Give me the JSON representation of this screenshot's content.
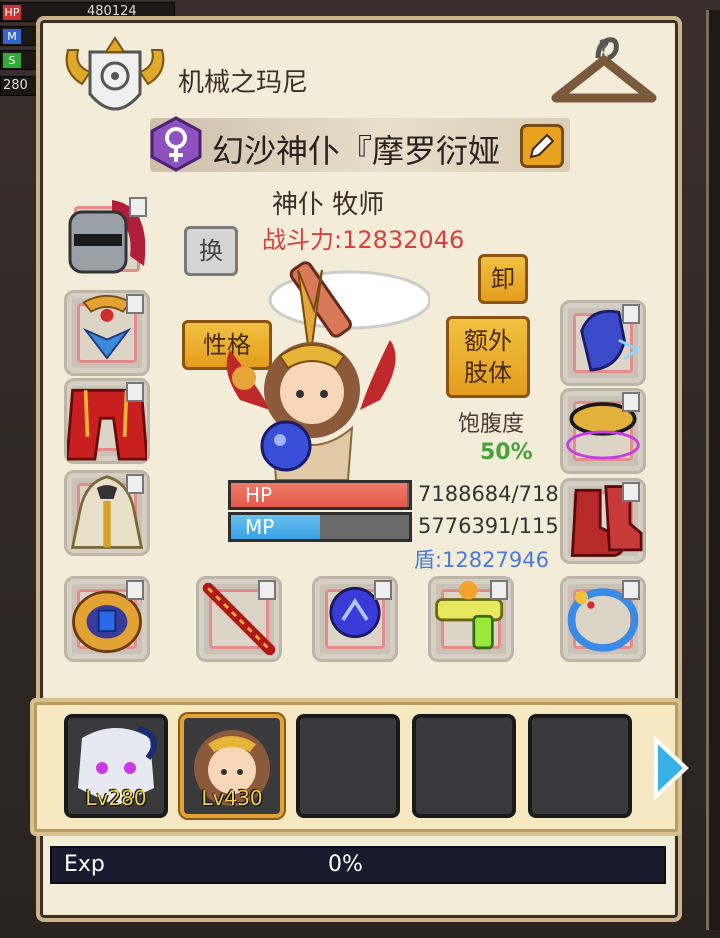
{
  "hud": {
    "hp_tag": "HP",
    "hp_value": "480124",
    "mp_tag": "M",
    "sp_tag": "S",
    "level": "280"
  },
  "header": {
    "guild_name": "机械之玛尼",
    "character_name": "幻沙神仆『摩罗衍娅",
    "class_line": "神仆 牧师",
    "power": "战斗力:12832046"
  },
  "buttons": {
    "swap": "换",
    "personality": "性格",
    "unequip": "卸",
    "extra_limbs_line1": "额外",
    "extra_limbs_line2": "肢体"
  },
  "satiety": {
    "label": "饱腹度",
    "value": "50%"
  },
  "stats": {
    "hp_label": "HP",
    "hp_value": "7188684/718",
    "hp_fraction": 0.99,
    "mp_label": "MP",
    "mp_value": "5776391/115",
    "mp_fraction": 0.5,
    "shield": "盾:12827946"
  },
  "roster": [
    {
      "level": "Lv280",
      "selected": false
    },
    {
      "level": "Lv430",
      "selected": true
    },
    {
      "level": "",
      "selected": false
    },
    {
      "level": "",
      "selected": false
    },
    {
      "level": "",
      "selected": false
    }
  ],
  "exp": {
    "label": "Exp",
    "value": "0%"
  },
  "equipment_icons": [
    "helmet-icon",
    "amulet-icon",
    "armor-icon",
    "cloak-icon",
    "ring-icon",
    "sword-icon",
    "orb-icon",
    "water-gun-icon",
    "bracelet-icon",
    "gauntlet-icon",
    "collar-icon",
    "boots-icon"
  ],
  "colors": {
    "hp_fill": "#e5574a",
    "mp_fill": "#3aa0e6",
    "power_red": "#d8403a",
    "satiety_green": "#47a33a",
    "shield_blue": "#4a7ad8"
  }
}
